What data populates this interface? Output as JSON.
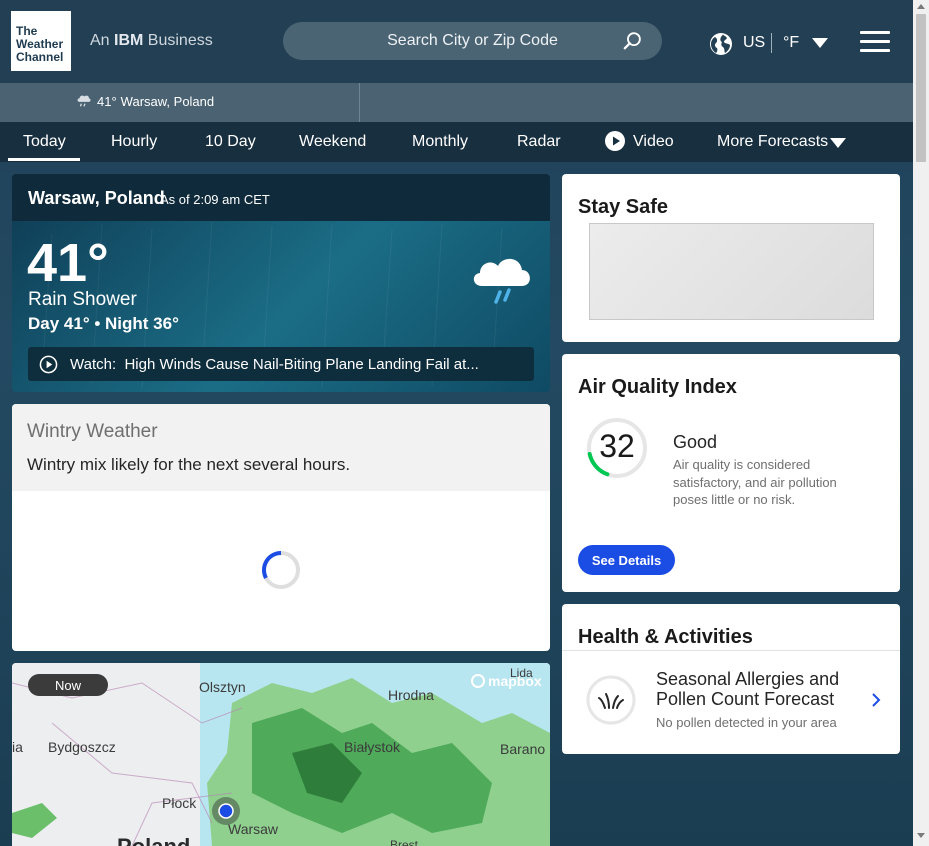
{
  "header": {
    "logo_line1": "The",
    "logo_line2": "Weather",
    "logo_line3": "Channel",
    "ibm_prefix": "An ",
    "ibm_brand": "IBM",
    "ibm_suffix": " Business",
    "search_placeholder": "Search City or Zip Code",
    "locale": "US",
    "unit": "°F",
    "icons": [
      "search-icon",
      "globe-icon",
      "caret-down-icon",
      "hamburger-menu-icon"
    ]
  },
  "recent_location": {
    "temp": "41°",
    "city": "Warsaw, Poland",
    "icon": "rain-cloud-icon"
  },
  "nav": {
    "items": [
      "Today",
      "Hourly",
      "10 Day",
      "Weekend",
      "Monthly",
      "Radar",
      "Video",
      "More Forecasts"
    ],
    "active": "Today"
  },
  "current_conditions": {
    "city": "Warsaw, Poland",
    "as_of": "As of 2:09 am CET",
    "temperature": "41°",
    "phrase": "Rain Shower",
    "day_night": "Day 41° • Night 36°",
    "watch_label": "Watch:",
    "watch_text": "High Winds Cause Nail-Biting Plane Landing Fail at..."
  },
  "wintry": {
    "title": "Wintry Weather",
    "message": "Wintry mix likely for the next several hours."
  },
  "map": {
    "now_label": "Now",
    "mapbox": "mapbox",
    "labels": {
      "olsztyn": "Olsztyn",
      "hrodna": "Hrodna",
      "lida": "Lida",
      "ia": "ia",
      "bydgoszcz": "Bydgoszcz",
      "bialystok": "Białystok",
      "barano": "Barano",
      "plock": "Płock",
      "warsaw": "Warsaw",
      "poland": "Poland",
      "brest": "Brest"
    }
  },
  "stay_safe": {
    "title": "Stay Safe"
  },
  "air_quality": {
    "title": "Air Quality Index",
    "value": "32",
    "status": "Good",
    "description": "Air quality is considered satisfactory, and air pollution poses little or no risk.",
    "button": "See Details",
    "gauge_fraction": 0.16,
    "gauge_color": "#00c853"
  },
  "health": {
    "title": "Health & Activities",
    "item_title": "Seasonal Allergies and Pollen Count Forecast",
    "item_sub": "No pollen detected in your area"
  },
  "colors": {
    "header_bg": "#233f53",
    "nav_bg": "#182f40",
    "accent_blue": "#1b4de4"
  }
}
